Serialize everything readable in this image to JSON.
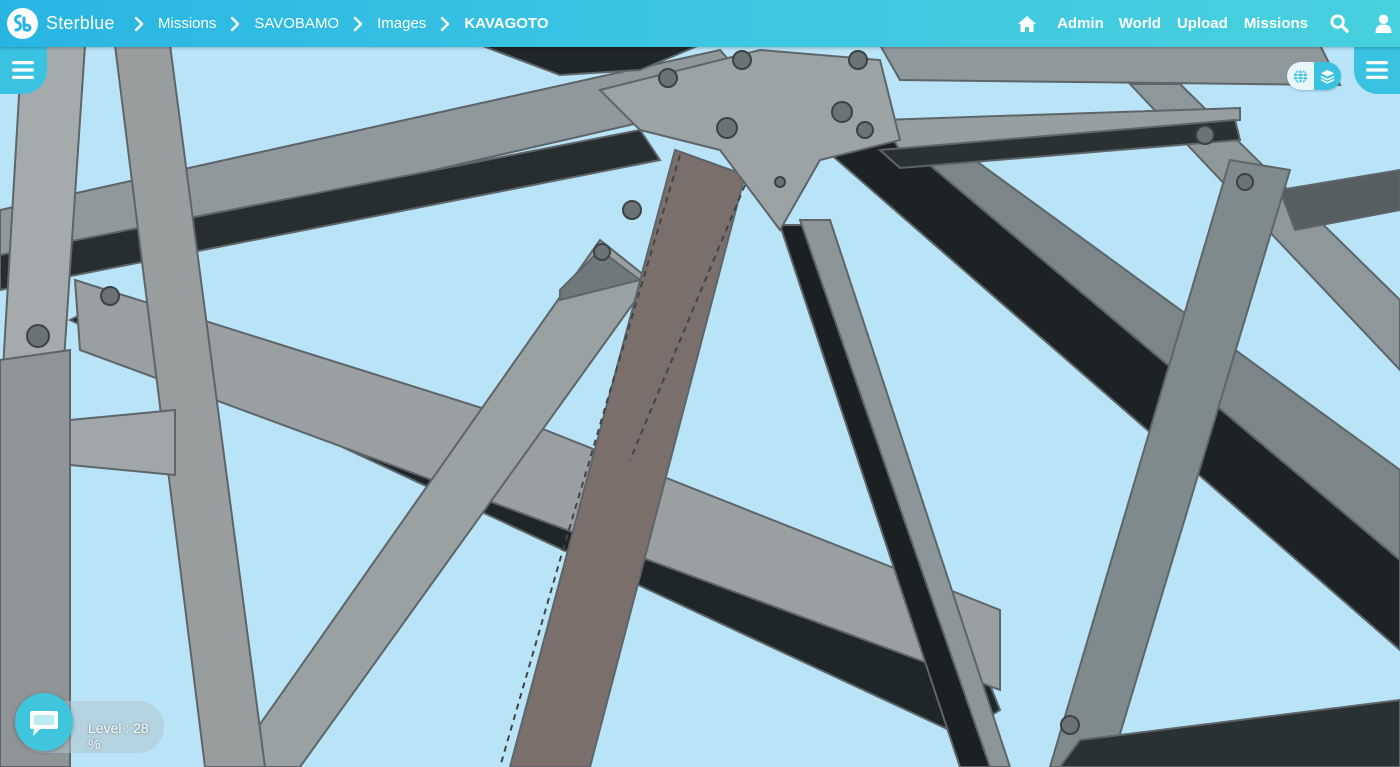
{
  "app": {
    "brand_name": "Sterblue",
    "brand_color": "#28b5e2",
    "accent_color": "#39c2e2"
  },
  "breadcrumb": [
    {
      "label": "Missions"
    },
    {
      "label": "SAVOBAMO"
    },
    {
      "label": "Images"
    },
    {
      "label": "KAVAGOTO"
    }
  ],
  "nav": {
    "home_icon": "home-icon",
    "links": [
      {
        "label": "Admin"
      },
      {
        "label": "World"
      },
      {
        "label": "Upload"
      },
      {
        "label": "Missions"
      }
    ],
    "search_icon": "search-icon",
    "user_icon": "user-icon"
  },
  "side_menus": {
    "left_icon": "hamburger-icon",
    "right_icon": "hamburger-icon"
  },
  "layer_toggle": {
    "options": [
      {
        "icon": "globe-icon",
        "active": false
      },
      {
        "icon": "layers-icon",
        "active": true
      }
    ]
  },
  "image_view": {
    "subject": "steel lattice tower beams",
    "sky_color": "#b9e3f7"
  },
  "status": {
    "level_text": "Level : 28 %",
    "level_percent": 28
  },
  "chat": {
    "icon": "chat-bubble-icon"
  }
}
